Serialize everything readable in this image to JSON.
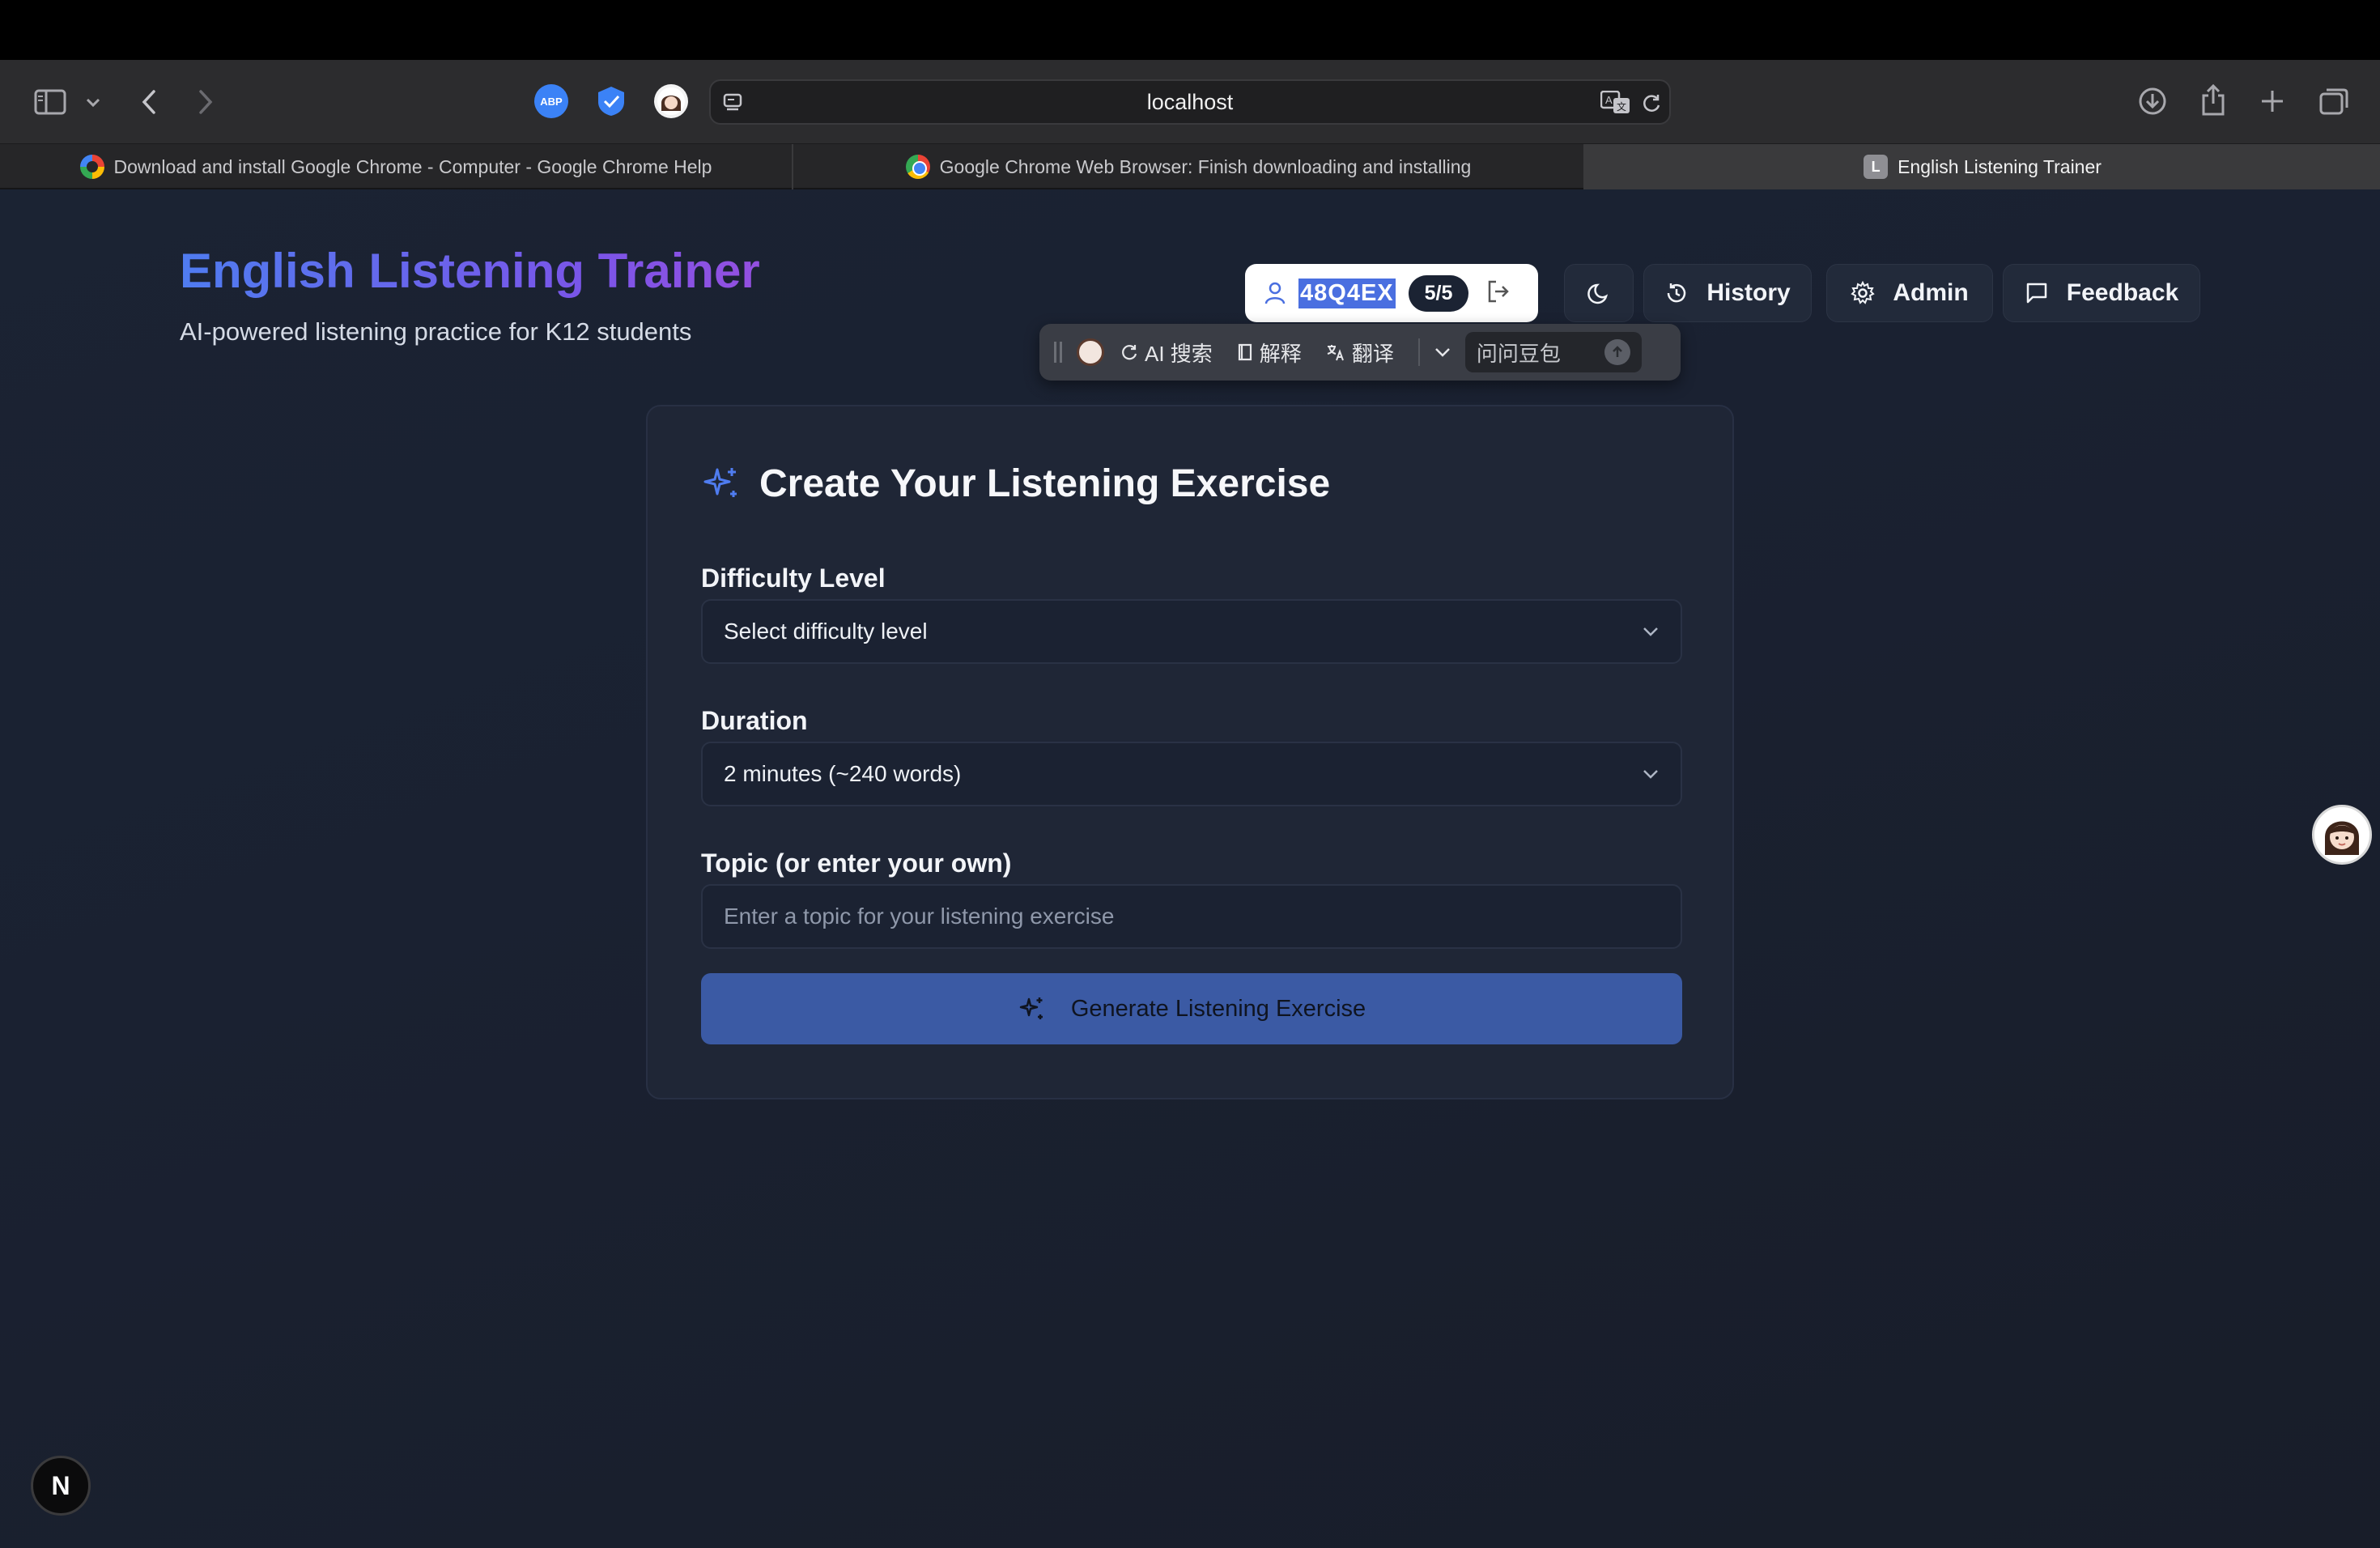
{
  "browser": {
    "url": "localhost",
    "tabs": [
      {
        "label": "Download and install Google Chrome - Computer - Google Chrome Help",
        "active": false,
        "icon": "google-g-icon"
      },
      {
        "label": "Google Chrome Web Browser: Finish downloading and installing",
        "active": false,
        "icon": "chrome-icon"
      },
      {
        "label": "English Listening Trainer",
        "active": true,
        "icon": "letter-l-icon",
        "favicon_letter": "L"
      }
    ],
    "extensions": [
      {
        "name": "abp-icon",
        "label": "ABP",
        "color": "#3b82f6"
      },
      {
        "name": "shield-extension-icon",
        "color": "#3b82f6"
      },
      {
        "name": "avatar-extension-icon",
        "color": "#ffffff"
      }
    ]
  },
  "header": {
    "title": "English Listening Trainer",
    "subtitle": "AI-powered listening practice for K12 students",
    "user_code": "48Q4EX",
    "quota": "5/5",
    "buttons": {
      "history": "History",
      "admin": "Admin",
      "feedback": "Feedback"
    }
  },
  "ai_toolbar": {
    "search": "AI 搜索",
    "explain": "解释",
    "translate": "翻译",
    "ask_placeholder": "问问豆包"
  },
  "form": {
    "title": "Create Your Listening Exercise",
    "difficulty": {
      "label": "Difficulty Level",
      "value": "Select difficulty level"
    },
    "duration": {
      "label": "Duration",
      "value": "2 minutes (~240 words)"
    },
    "topic": {
      "label": "Topic (or enter your own)",
      "placeholder": "Enter a topic for your listening exercise"
    },
    "generate_label": "Generate Listening Exercise"
  },
  "badges": {
    "nextjs": "N"
  },
  "colors": {
    "accent": "#4f7cf0",
    "title_gradient_end": "#9450e0",
    "generate_button": "#3b5aa4",
    "page_bg": "#1b2333"
  }
}
